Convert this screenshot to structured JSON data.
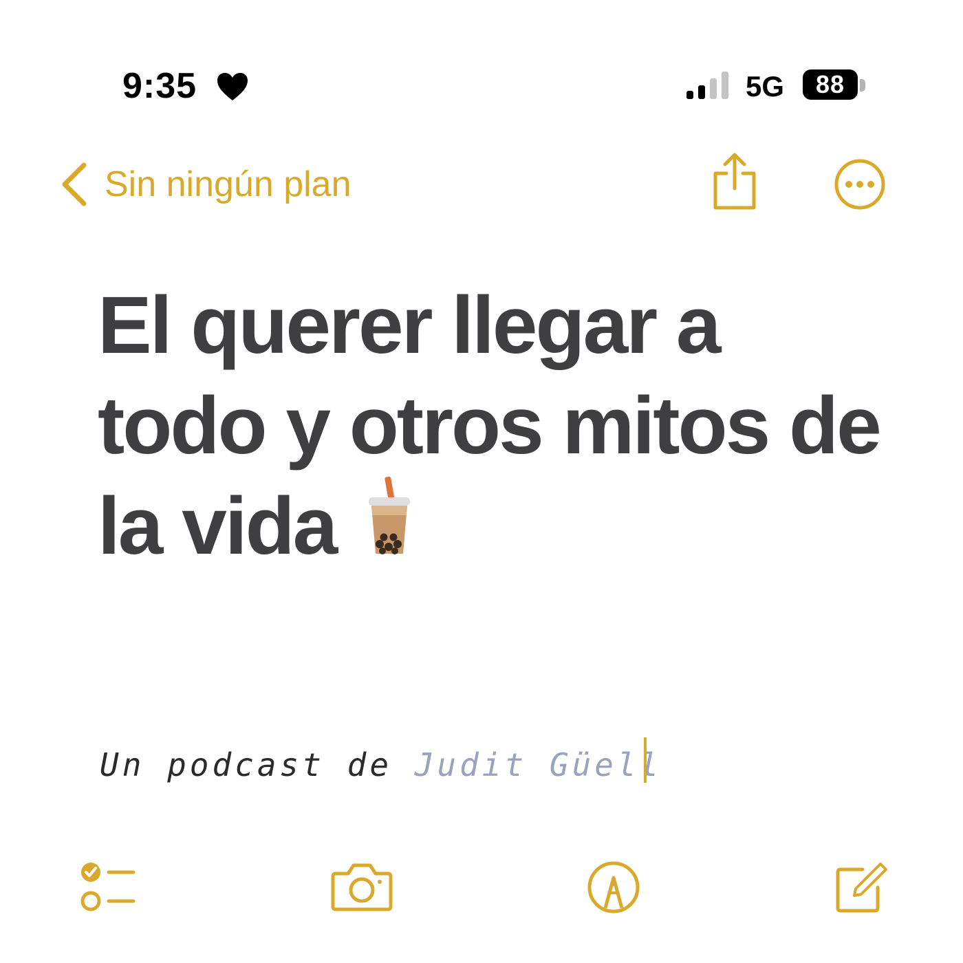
{
  "status_bar": {
    "time": "9:35",
    "network": "5G",
    "battery": "88",
    "icons": [
      "heart-icon",
      "signal-icon",
      "battery-icon"
    ]
  },
  "nav": {
    "back_label": "Sin ningún plan",
    "accent_color": "#d9a92b",
    "icons": [
      "chevron-left-icon",
      "share-icon",
      "more-icon"
    ]
  },
  "note": {
    "title_lines": [
      "El querer llegar a",
      "todo y otros mitos de",
      "la vida"
    ],
    "title_emoji": "bubble-tea-icon",
    "subtitle_prefix": "Un podcast de",
    "subtitle_author": "Judit Güell",
    "title_color": "#3f3f41",
    "author_color": "#9aa3bd"
  },
  "toolbar": {
    "items": [
      "checklist-icon",
      "camera-icon",
      "markup-icon",
      "compose-icon"
    ]
  }
}
